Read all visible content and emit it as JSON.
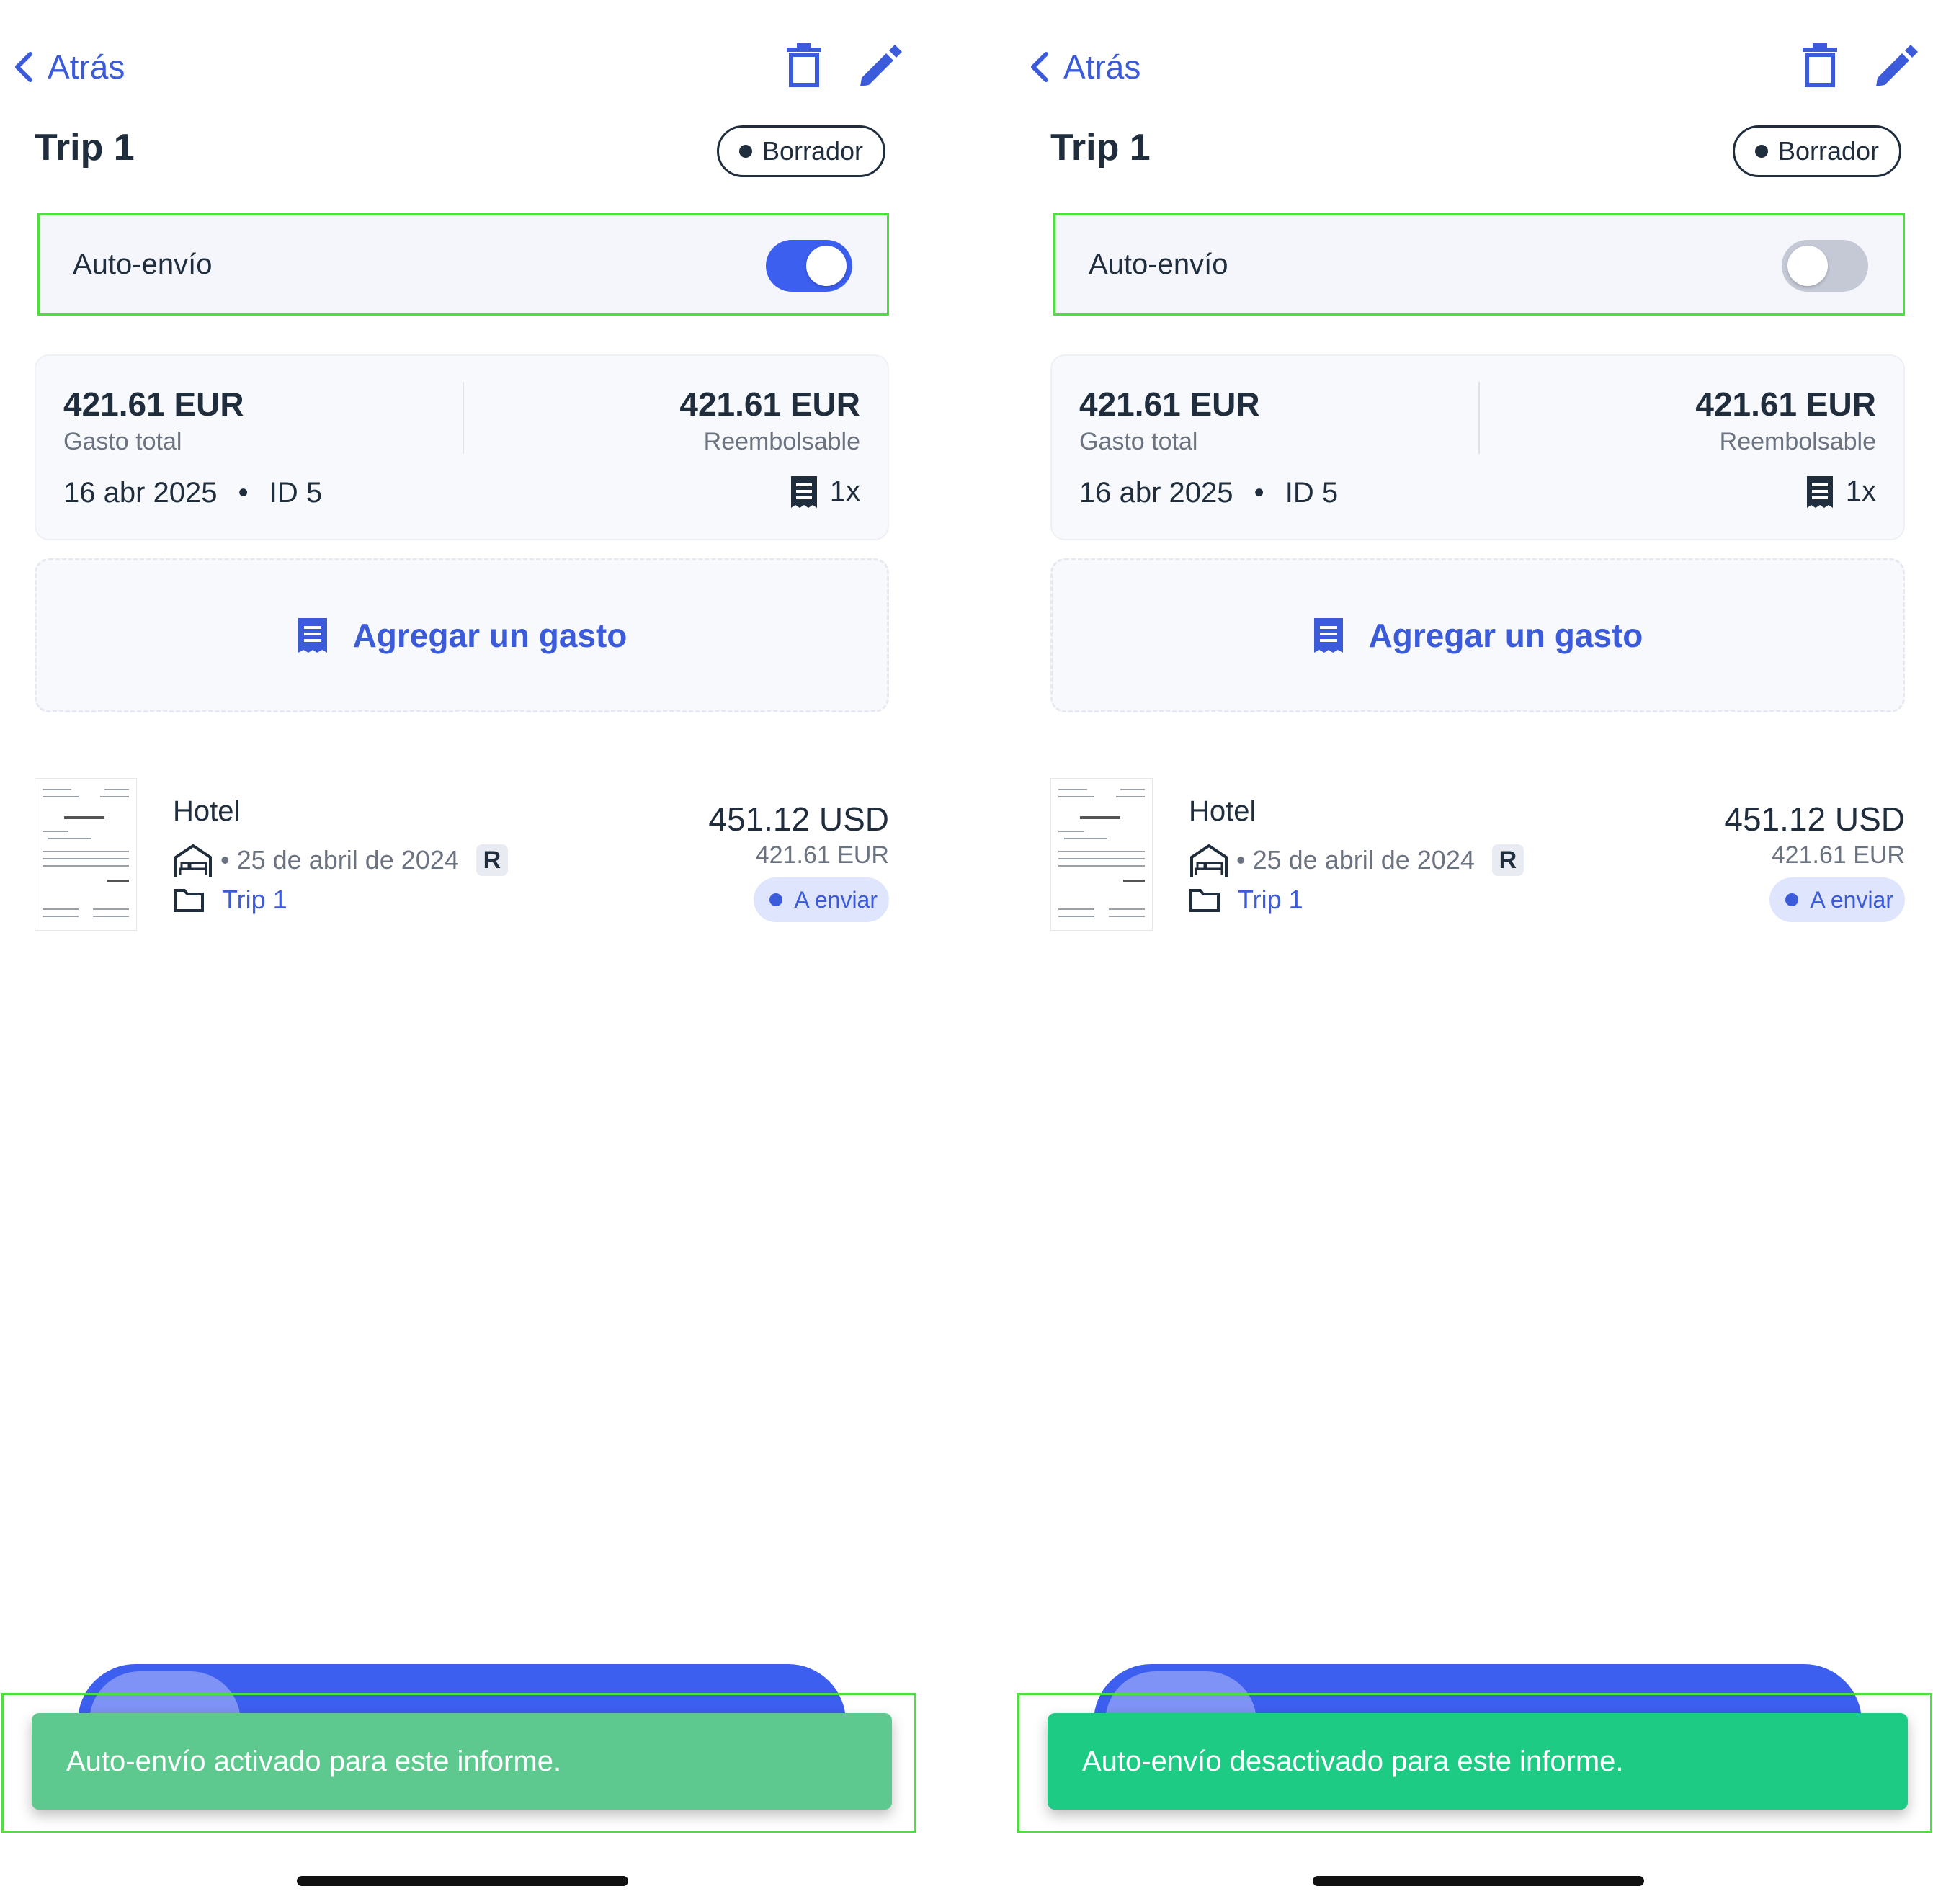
{
  "panels": [
    {
      "nav": {
        "back_label": "Atrás"
      },
      "report": {
        "title": "Trip 1",
        "status": "Borrador"
      },
      "auto_submit": {
        "label": "Auto-envío",
        "enabled": true
      },
      "summary": {
        "total_amount": "421.61 EUR",
        "total_label": "Gasto total",
        "reimbursable_amount": "421.61 EUR",
        "reimbursable_label": "Reembolsable",
        "date": "16 abr 2025",
        "separator": "•",
        "id": "ID 5",
        "receipt_count": "1x"
      },
      "add_expense_label": "Agregar un gasto",
      "expense": {
        "category": "Hotel",
        "date": "25 de abril de 2024",
        "badge": "R",
        "report": "Trip 1",
        "amount": "451.12 USD",
        "converted": "421.61 EUR",
        "status": "A enviar"
      },
      "toast": "Auto-envío activado para este informe."
    },
    {
      "nav": {
        "back_label": "Atrás"
      },
      "report": {
        "title": "Trip 1",
        "status": "Borrador"
      },
      "auto_submit": {
        "label": "Auto-envío",
        "enabled": false
      },
      "summary": {
        "total_amount": "421.61 EUR",
        "total_label": "Gasto total",
        "reimbursable_amount": "421.61 EUR",
        "reimbursable_label": "Reembolsable",
        "date": "16 abr 2025",
        "separator": "•",
        "id": "ID 5",
        "receipt_count": "1x"
      },
      "add_expense_label": "Agregar un gasto",
      "expense": {
        "category": "Hotel",
        "date": "25 de abril de 2024",
        "badge": "R",
        "report": "Trip 1",
        "amount": "451.12 USD",
        "converted": "421.61 EUR",
        "status": "A enviar"
      },
      "toast": "Auto-envío desactivado para este informe."
    }
  ],
  "colors": {
    "accent": "#3D5FF0",
    "text": "#1F2D3D",
    "muted": "#6B7280",
    "toast_activated": "#5DC98E",
    "toast_deactivated": "#1ECB84",
    "highlight_outline": "#4CE03C"
  },
  "icons": [
    "chevron-left-icon",
    "trash-icon",
    "pencil-icon",
    "receipt-icon",
    "bed-icon",
    "folder-icon"
  ]
}
